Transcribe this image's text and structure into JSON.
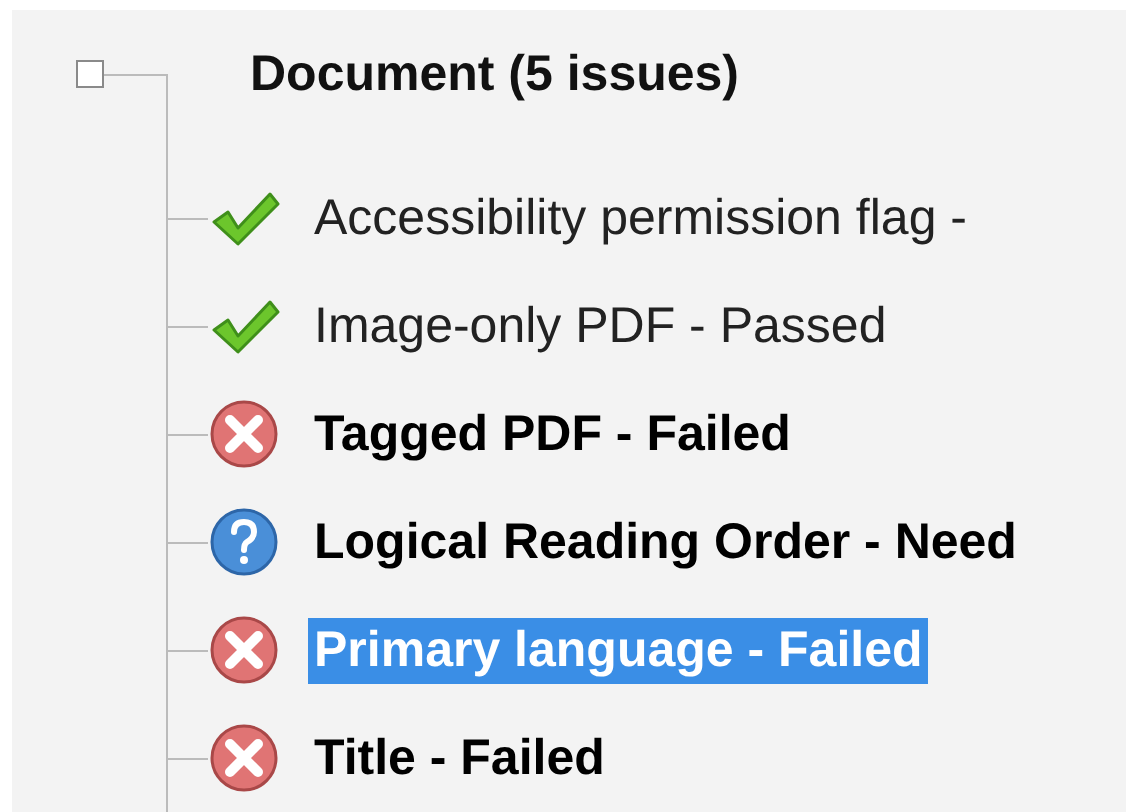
{
  "tree": {
    "title": "Document (5 issues)",
    "items": [
      {
        "label": "Accessibility permission flag -",
        "kind": "passed",
        "selected": false
      },
      {
        "label": "Image-only PDF - Passed",
        "kind": "passed",
        "selected": false
      },
      {
        "label": "Tagged PDF - Failed",
        "kind": "failed",
        "selected": false
      },
      {
        "label": "Logical Reading Order - Need",
        "kind": "check",
        "selected": false
      },
      {
        "label": "Primary language - Failed",
        "kind": "failed",
        "selected": true
      },
      {
        "label": "Title - Failed",
        "kind": "failed",
        "selected": false
      }
    ]
  }
}
